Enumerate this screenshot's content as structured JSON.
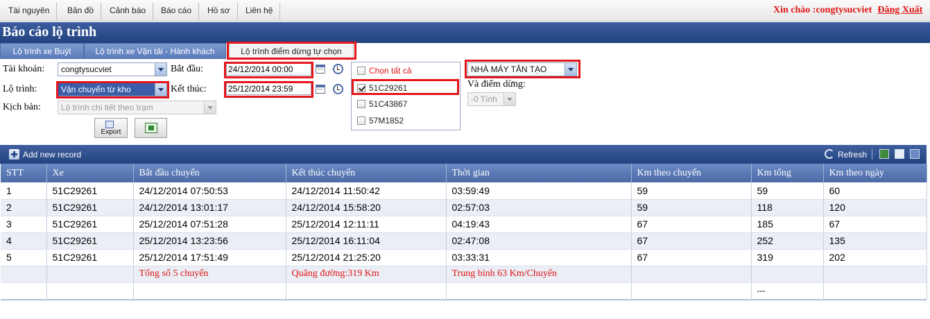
{
  "menu": [
    "Tài nguyên",
    "Bản đồ",
    "Cảnh báo",
    "Báo cáo",
    "Hồ sơ",
    "Liên hệ"
  ],
  "greeting": "Xin chào :congtysucviet",
  "logout": "Đăng Xuất",
  "page_title": "Báo cáo lộ trình",
  "tabs": [
    "Lộ trình xe Buýt",
    "Lộ trình xe Vận tải - Hành khách",
    "Lộ trình điểm dừng tự chọn"
  ],
  "form": {
    "account_label": "Tài khoản:",
    "account_value": "congtysucviet",
    "route_label": "Lộ trình:",
    "route_value": "Vận chuyển từ kho",
    "scenario_label": "Kịch bản:",
    "scenario_value": "Lộ trình chi tiết theo trạm",
    "start_label": "Bắt đầu:",
    "start_value": "24/12/2014 00:00",
    "end_label": "Kết thúc:",
    "end_value": "25/12/2014 23:59",
    "select_all": "Chọn tất cả",
    "vehicles": [
      {
        "plate": "51C29261",
        "checked": true
      },
      {
        "plate": "51C43867",
        "checked": false
      },
      {
        "plate": "57M1852",
        "checked": false
      }
    ],
    "location_value": "NHÀ MÁY TÂN TẠO",
    "stop_label": "Và điểm dừng:",
    "stop_value": "-0 Tính",
    "export_label": "Export"
  },
  "grid": {
    "add_label": "Add new record",
    "refresh_label": "Refresh",
    "columns": [
      "STT",
      "Xe",
      "Bắt đầu chuyến",
      "Kết thúc chuyến",
      "Thời gian",
      "Km theo chuyến",
      "Km tổng",
      "Km theo ngày"
    ],
    "rows": [
      [
        "1",
        "51C29261",
        "24/12/2014 07:50:53",
        "24/12/2014 11:50:42",
        "03:59:49",
        "59",
        "59",
        "60"
      ],
      [
        "2",
        "51C29261",
        "24/12/2014 13:01:17",
        "24/12/2014 15:58:20",
        "02:57:03",
        "59",
        "118",
        "120"
      ],
      [
        "3",
        "51C29261",
        "25/12/2014 07:51:28",
        "25/12/2014 12:11:11",
        "04:19:43",
        "67",
        "185",
        "67"
      ],
      [
        "4",
        "51C29261",
        "25/12/2014 13:23:56",
        "25/12/2014 16:11:04",
        "02:47:08",
        "67",
        "252",
        "135"
      ],
      [
        "5",
        "51C29261",
        "25/12/2014 17:51:49",
        "25/12/2014 21:25:20",
        "03:33:31",
        "67",
        "319",
        "202"
      ]
    ],
    "summary": {
      "total_trips": "Tổng số 5 chuyến",
      "distance": "Quãng đường:319 Km",
      "average": "Trung bình 63 Km/Chuyến"
    },
    "footer_dash": "---"
  },
  "colors": {
    "accent_red": "#e01414",
    "header_blue": "#22437f"
  }
}
